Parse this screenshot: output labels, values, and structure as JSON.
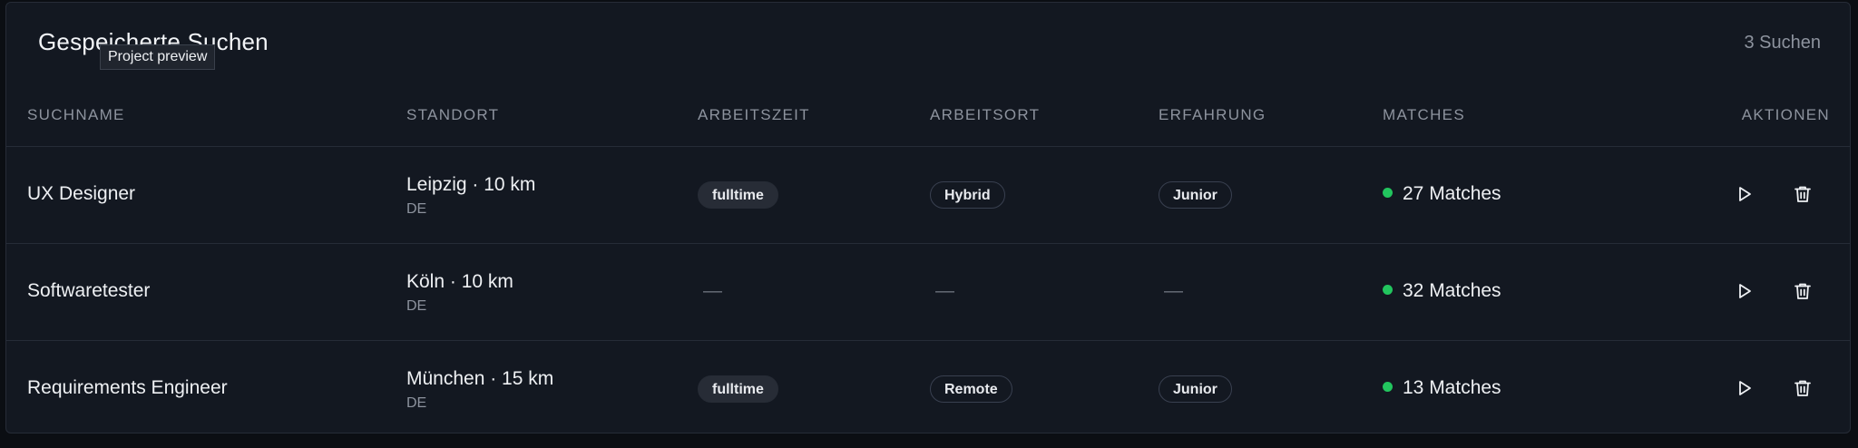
{
  "header": {
    "title": "Gespeicherte Suchen",
    "count": "3 Suchen",
    "tooltip": "Project preview"
  },
  "columns": {
    "name": "SUCHNAME",
    "location": "STANDORT",
    "worktime": "ARBEITSZEIT",
    "workplace": "ARBEITSORT",
    "experience": "ERFAHRUNG",
    "matches": "MATCHES",
    "actions": "AKTIONEN"
  },
  "rows": [
    {
      "name": "UX Designer",
      "location": "Leipzig · 10 km",
      "country": "DE",
      "worktime": "fulltime",
      "workplace": "Hybrid",
      "experience": "Junior",
      "matches": "27 Matches"
    },
    {
      "name": "Softwaretester",
      "location": "Köln · 10 km",
      "country": "DE",
      "worktime": "—",
      "workplace": "—",
      "experience": "—",
      "matches": "32 Matches"
    },
    {
      "name": "Requirements Engineer",
      "location": "München · 15 km",
      "country": "DE",
      "worktime": "fulltime",
      "workplace": "Remote",
      "experience": "Junior",
      "matches": "13 Matches"
    }
  ],
  "icons": {
    "run": "play-icon",
    "delete": "trash-icon",
    "status": "status-dot"
  },
  "colors": {
    "background": "#131821",
    "accent_green": "#22c55e",
    "text_primary": "#eef0f3",
    "text_muted": "#8d939e"
  }
}
